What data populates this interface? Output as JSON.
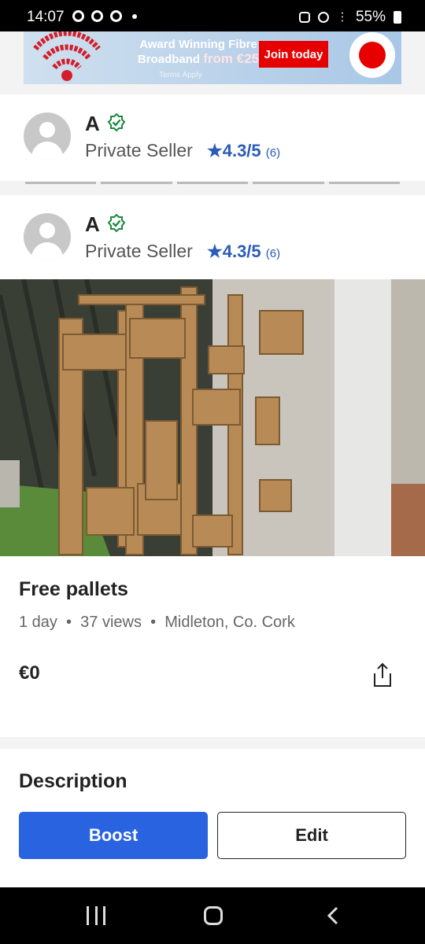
{
  "status_bar": {
    "time": "14:07",
    "battery": "55%"
  },
  "ad": {
    "headline_line1": "Award Winning Fibre",
    "headline_line2": "Broadband",
    "headline_from": "from €25",
    "cta": "Join today",
    "terms": "Terms Apply",
    "brand_color": "#e60000"
  },
  "seller_cards": [
    {
      "name": "A",
      "type": "Private Seller",
      "rating": "★4.3/5",
      "rating_count": "(6)"
    },
    {
      "name": "A",
      "type": "Private Seller",
      "rating": "★4.3/5",
      "rating_count": "(6)"
    }
  ],
  "listing": {
    "title": "Free pallets",
    "age": "1 day",
    "views": "37 views",
    "location": "Midleton, Co. Cork",
    "price": "€0"
  },
  "description": {
    "heading": "Description",
    "boost_label": "Boost",
    "edit_label": "Edit",
    "accent": "#2a63e0"
  },
  "icons": [
    "chrome-icon",
    "verified-icon",
    "star-icon",
    "share-icon",
    "recents-icon",
    "home-icon",
    "back-icon"
  ]
}
